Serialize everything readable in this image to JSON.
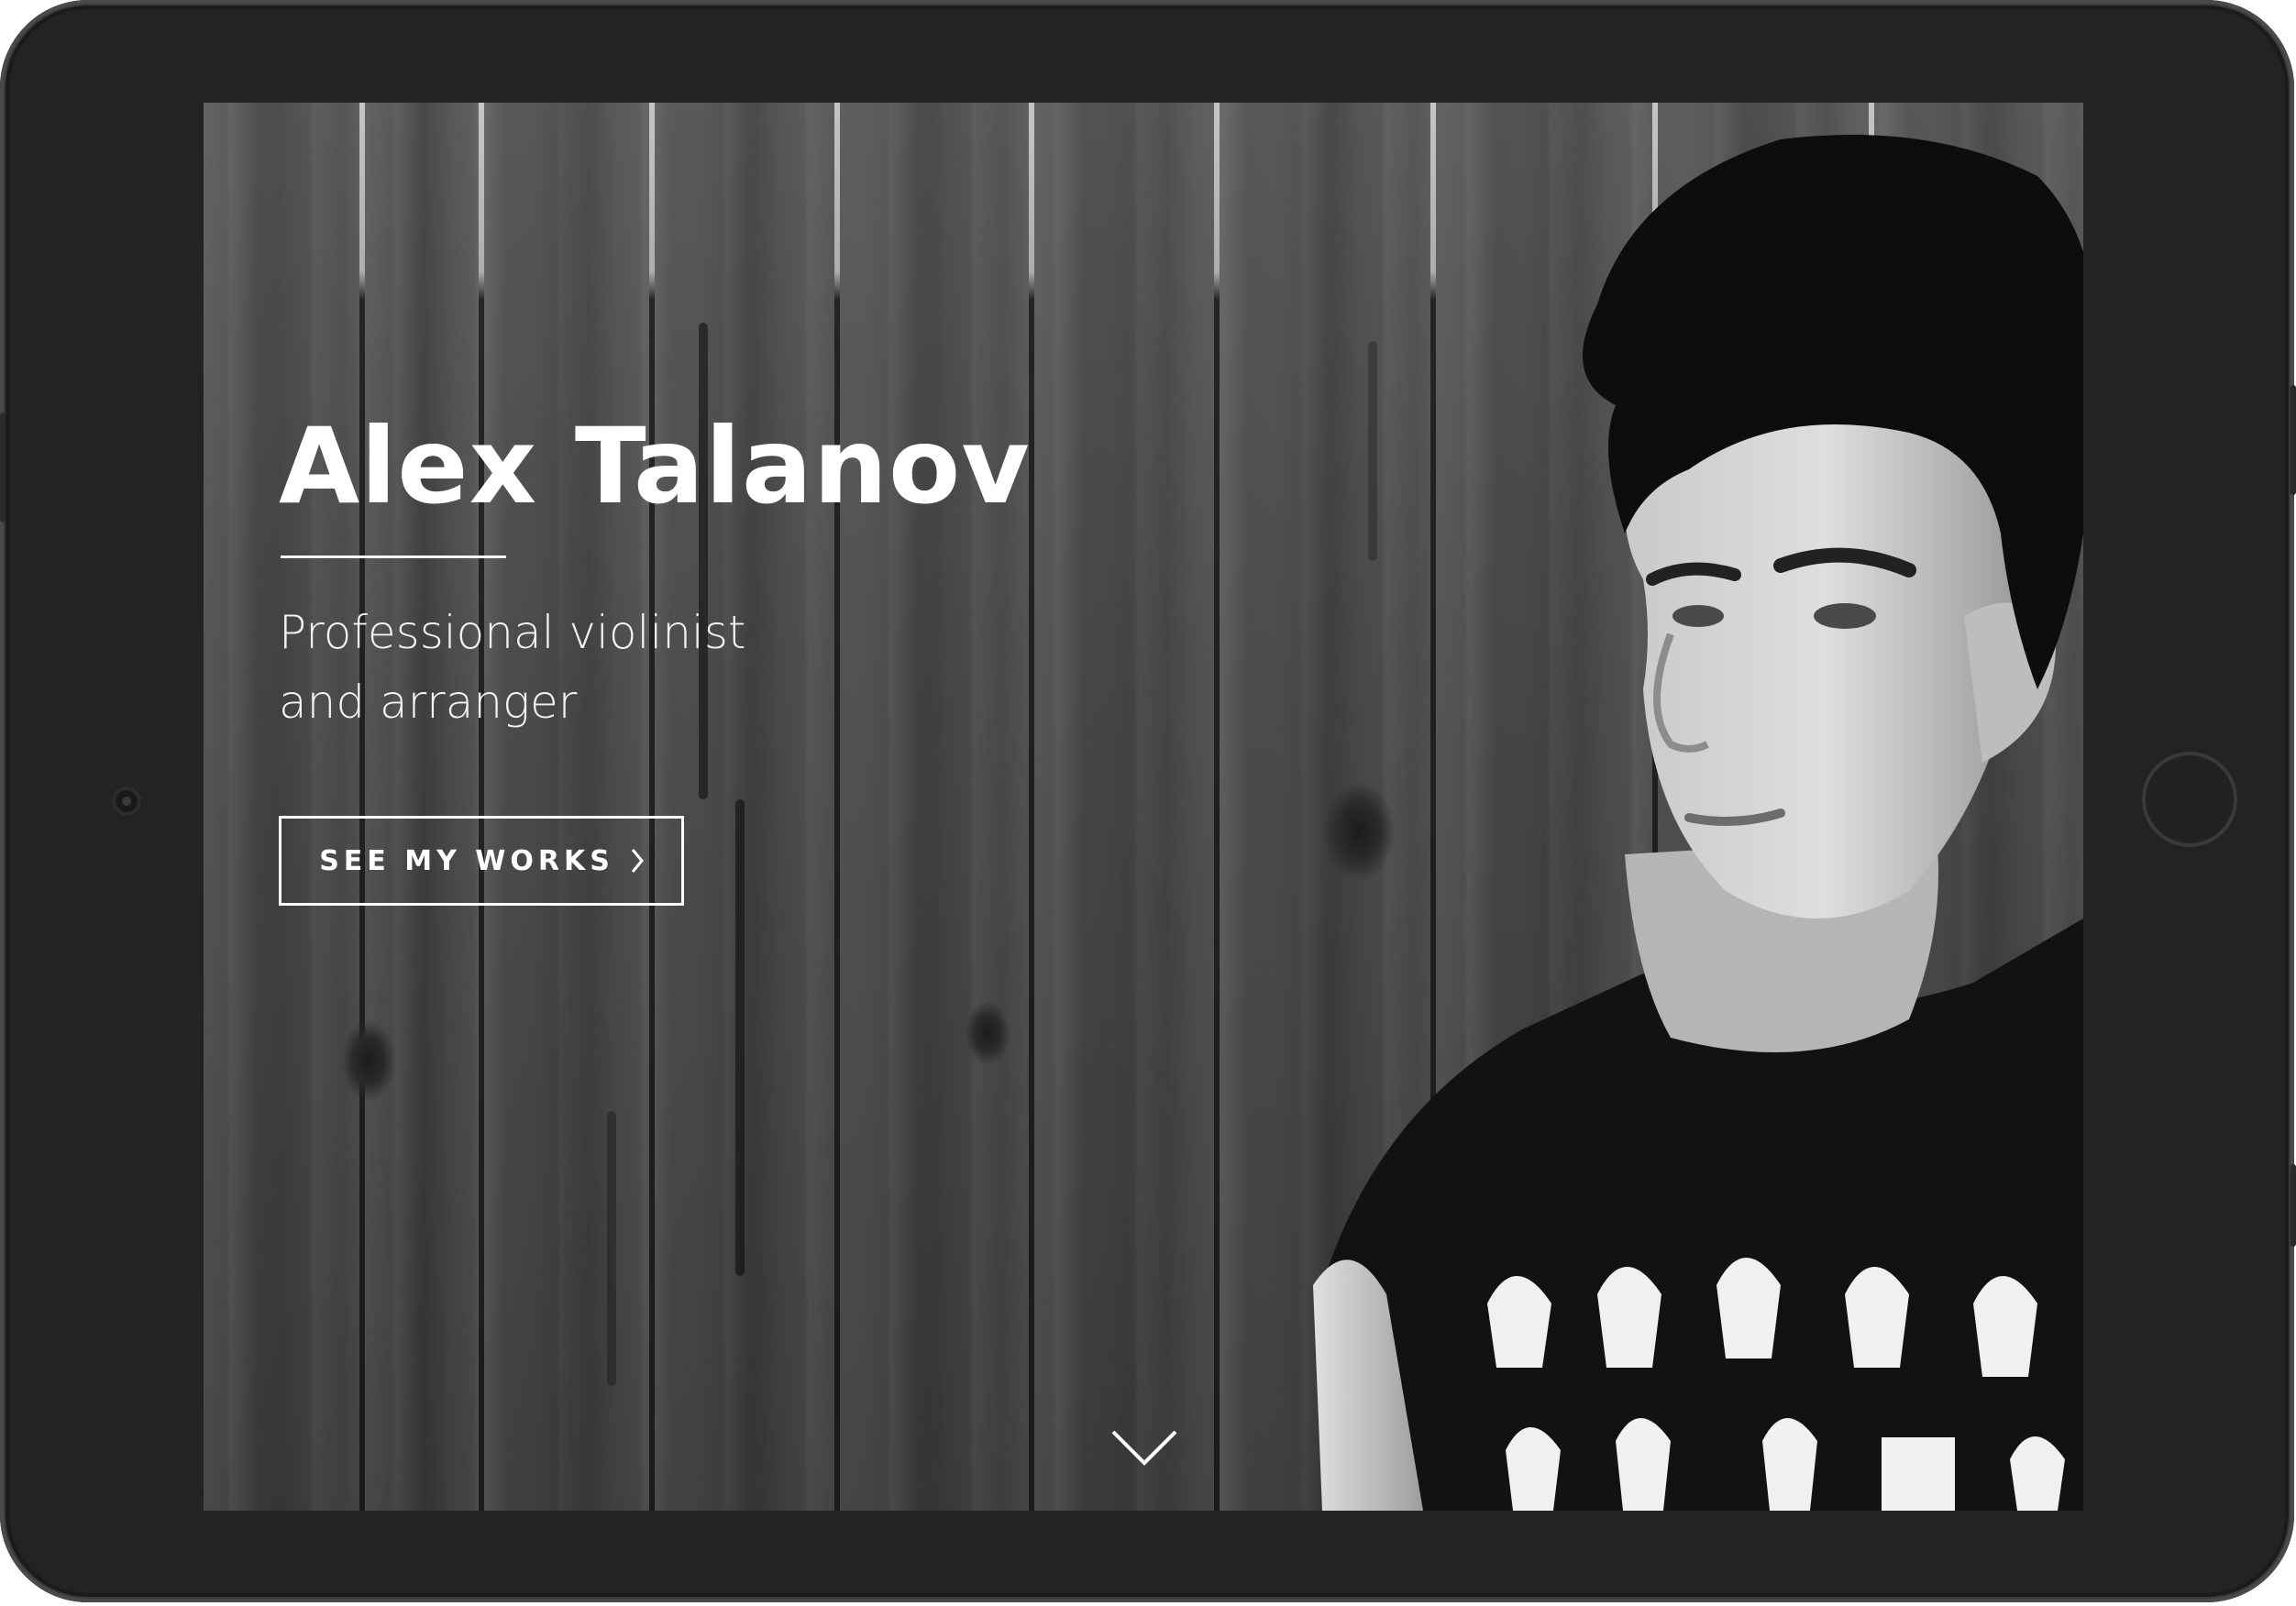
{
  "hero": {
    "title": "Alex Talanov",
    "subtitle_line1": "Professional violinist",
    "subtitle_line2": "and arranger",
    "cta_label": "SEE MY WORKS",
    "cta_icon": "chevron-right-icon",
    "scroll_icon": "chevron-down-icon",
    "image": "portrait-photo"
  },
  "colors": {
    "device_frame": "#232323",
    "text": "#ffffff",
    "background_tone": "#4b4b4b"
  }
}
